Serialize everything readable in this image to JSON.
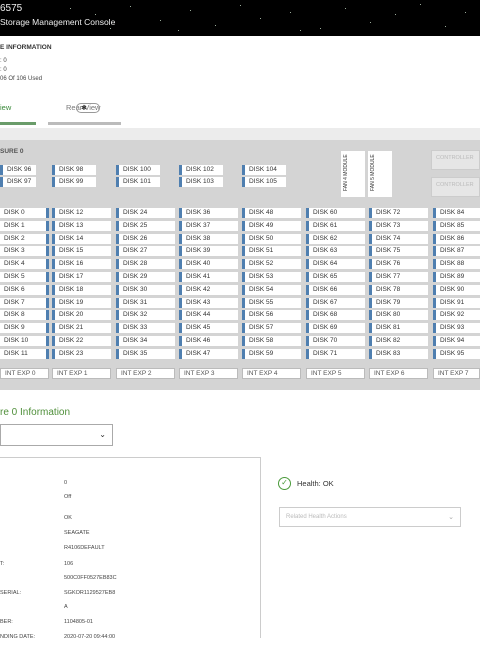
{
  "header": {
    "title": "6575",
    "subtitle": "Storage Management Console"
  },
  "info": {
    "title": "E INFORMATION",
    "lines": [
      ": 0",
      ": 0",
      "06 Of 106 Used"
    ]
  },
  "tabs": {
    "front": "iew",
    "rear": "Rear View"
  },
  "enclosure": {
    "label": "SURE 0",
    "top_disks": [
      "DISK 96",
      "DISK 98",
      "DISK 100",
      "DISK 102",
      "DISK 104",
      "DISK 97",
      "DISK 99",
      "DISK 101",
      "DISK 103",
      "DISK 105"
    ],
    "fans": [
      "FAN 4 MODULE",
      "FAN 5 MODULE"
    ],
    "controllers": [
      "CONTROLLER",
      "CONTROLLER"
    ],
    "grid_disks": [
      [
        "DISK 0",
        "DISK 12",
        "DISK 24",
        "DISK 36",
        "DISK 48",
        "DISK 60",
        "DISK 72",
        "DISK 84"
      ],
      [
        "DISK 1",
        "DISK 13",
        "DISK 25",
        "DISK 37",
        "DISK 49",
        "DISK 61",
        "DISK 73",
        "DISK 85"
      ],
      [
        "DISK 2",
        "DISK 14",
        "DISK 26",
        "DISK 38",
        "DISK 50",
        "DISK 62",
        "DISK 74",
        "DISK 86"
      ],
      [
        "DISK 3",
        "DISK 15",
        "DISK 27",
        "DISK 39",
        "DISK 51",
        "DISK 63",
        "DISK 75",
        "DISK 87"
      ],
      [
        "DISK 4",
        "DISK 16",
        "DISK 28",
        "DISK 40",
        "DISK 52",
        "DISK 64",
        "DISK 76",
        "DISK 88"
      ],
      [
        "DISK 5",
        "DISK 17",
        "DISK 29",
        "DISK 41",
        "DISK 53",
        "DISK 65",
        "DISK 77",
        "DISK 89"
      ],
      [
        "DISK 6",
        "DISK 18",
        "DISK 30",
        "DISK 42",
        "DISK 54",
        "DISK 66",
        "DISK 78",
        "DISK 90"
      ],
      [
        "DISK 7",
        "DISK 19",
        "DISK 31",
        "DISK 43",
        "DISK 55",
        "DISK 67",
        "DISK 79",
        "DISK 91"
      ],
      [
        "DISK 8",
        "DISK 20",
        "DISK 32",
        "DISK 44",
        "DISK 56",
        "DISK 68",
        "DISK 80",
        "DISK 92"
      ],
      [
        "DISK 9",
        "DISK 21",
        "DISK 33",
        "DISK 45",
        "DISK 57",
        "DISK 69",
        "DISK 81",
        "DISK 93"
      ],
      [
        "DISK 10",
        "DISK 22",
        "DISK 34",
        "DISK 46",
        "DISK 58",
        "DISK 70",
        "DISK 82",
        "DISK 94"
      ],
      [
        "DISK 11",
        "DISK 23",
        "DISK 35",
        "DISK 47",
        "DISK 59",
        "DISK 71",
        "DISK 83",
        "DISK 95"
      ]
    ],
    "expanders": [
      "INT EXP 0",
      "INT EXP 1",
      "INT EXP 2",
      "INT EXP 3",
      "INT EXP 4",
      "INT EXP 5",
      "INT EXP 6",
      "INT EXP 7"
    ]
  },
  "lower": {
    "heading": "re 0 Information",
    "properties": [
      {
        "key": "",
        "value": "0"
      },
      {
        "key": "",
        "value": "Off"
      },
      {
        "key": "",
        "value": "OK"
      },
      {
        "key": "",
        "value": "SEAGATE"
      },
      {
        "key": "",
        "value": "R4106DEFAULT"
      },
      {
        "key": "T:",
        "value": "106"
      },
      {
        "key": "",
        "value": "500C0FF0527EB83C"
      },
      {
        "key": "SERIAL:",
        "value": "SGKOR1129527EB8"
      },
      {
        "key": "",
        "value": "A"
      },
      {
        "key": "BER:",
        "value": "1104805-01"
      },
      {
        "key": "NDING DATE:",
        "value": "2020-07-20 09:44:00"
      }
    ],
    "health": "Health: OK",
    "actions_placeholder": "Related Health Actions"
  },
  "colors": {
    "accent_green": "#4f8f3a",
    "disk_bar": "#4f7fb0",
    "header_bg": "#000000"
  }
}
